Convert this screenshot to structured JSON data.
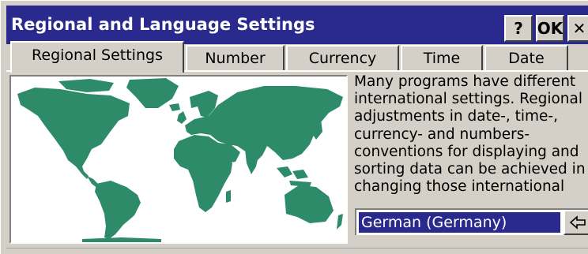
{
  "window": {
    "title": "Regional and Language Settings",
    "help_label": "?",
    "ok_label": "OK",
    "close_label": "✕",
    "title_bar_color": "#2a2a8e"
  },
  "tabs": [
    {
      "label": "Regional Settings",
      "active": true
    },
    {
      "label": "Number",
      "active": false
    },
    {
      "label": "Currency",
      "active": false
    },
    {
      "label": "Time",
      "active": false
    },
    {
      "label": "Date",
      "active": false
    }
  ],
  "map": {
    "land_color": "#2e8b6a",
    "water_color": "#ffffff"
  },
  "description_lines": [
    "Many programs have different",
    "international settings. Regional",
    "adjustments in date-, time-,",
    "currency- and numbers-",
    "conventions for displaying and",
    "sorting data can be achieved in",
    "changing those international"
  ],
  "language_select": {
    "value": "German (Germany)",
    "button_icon": "arrow-left-icon"
  }
}
